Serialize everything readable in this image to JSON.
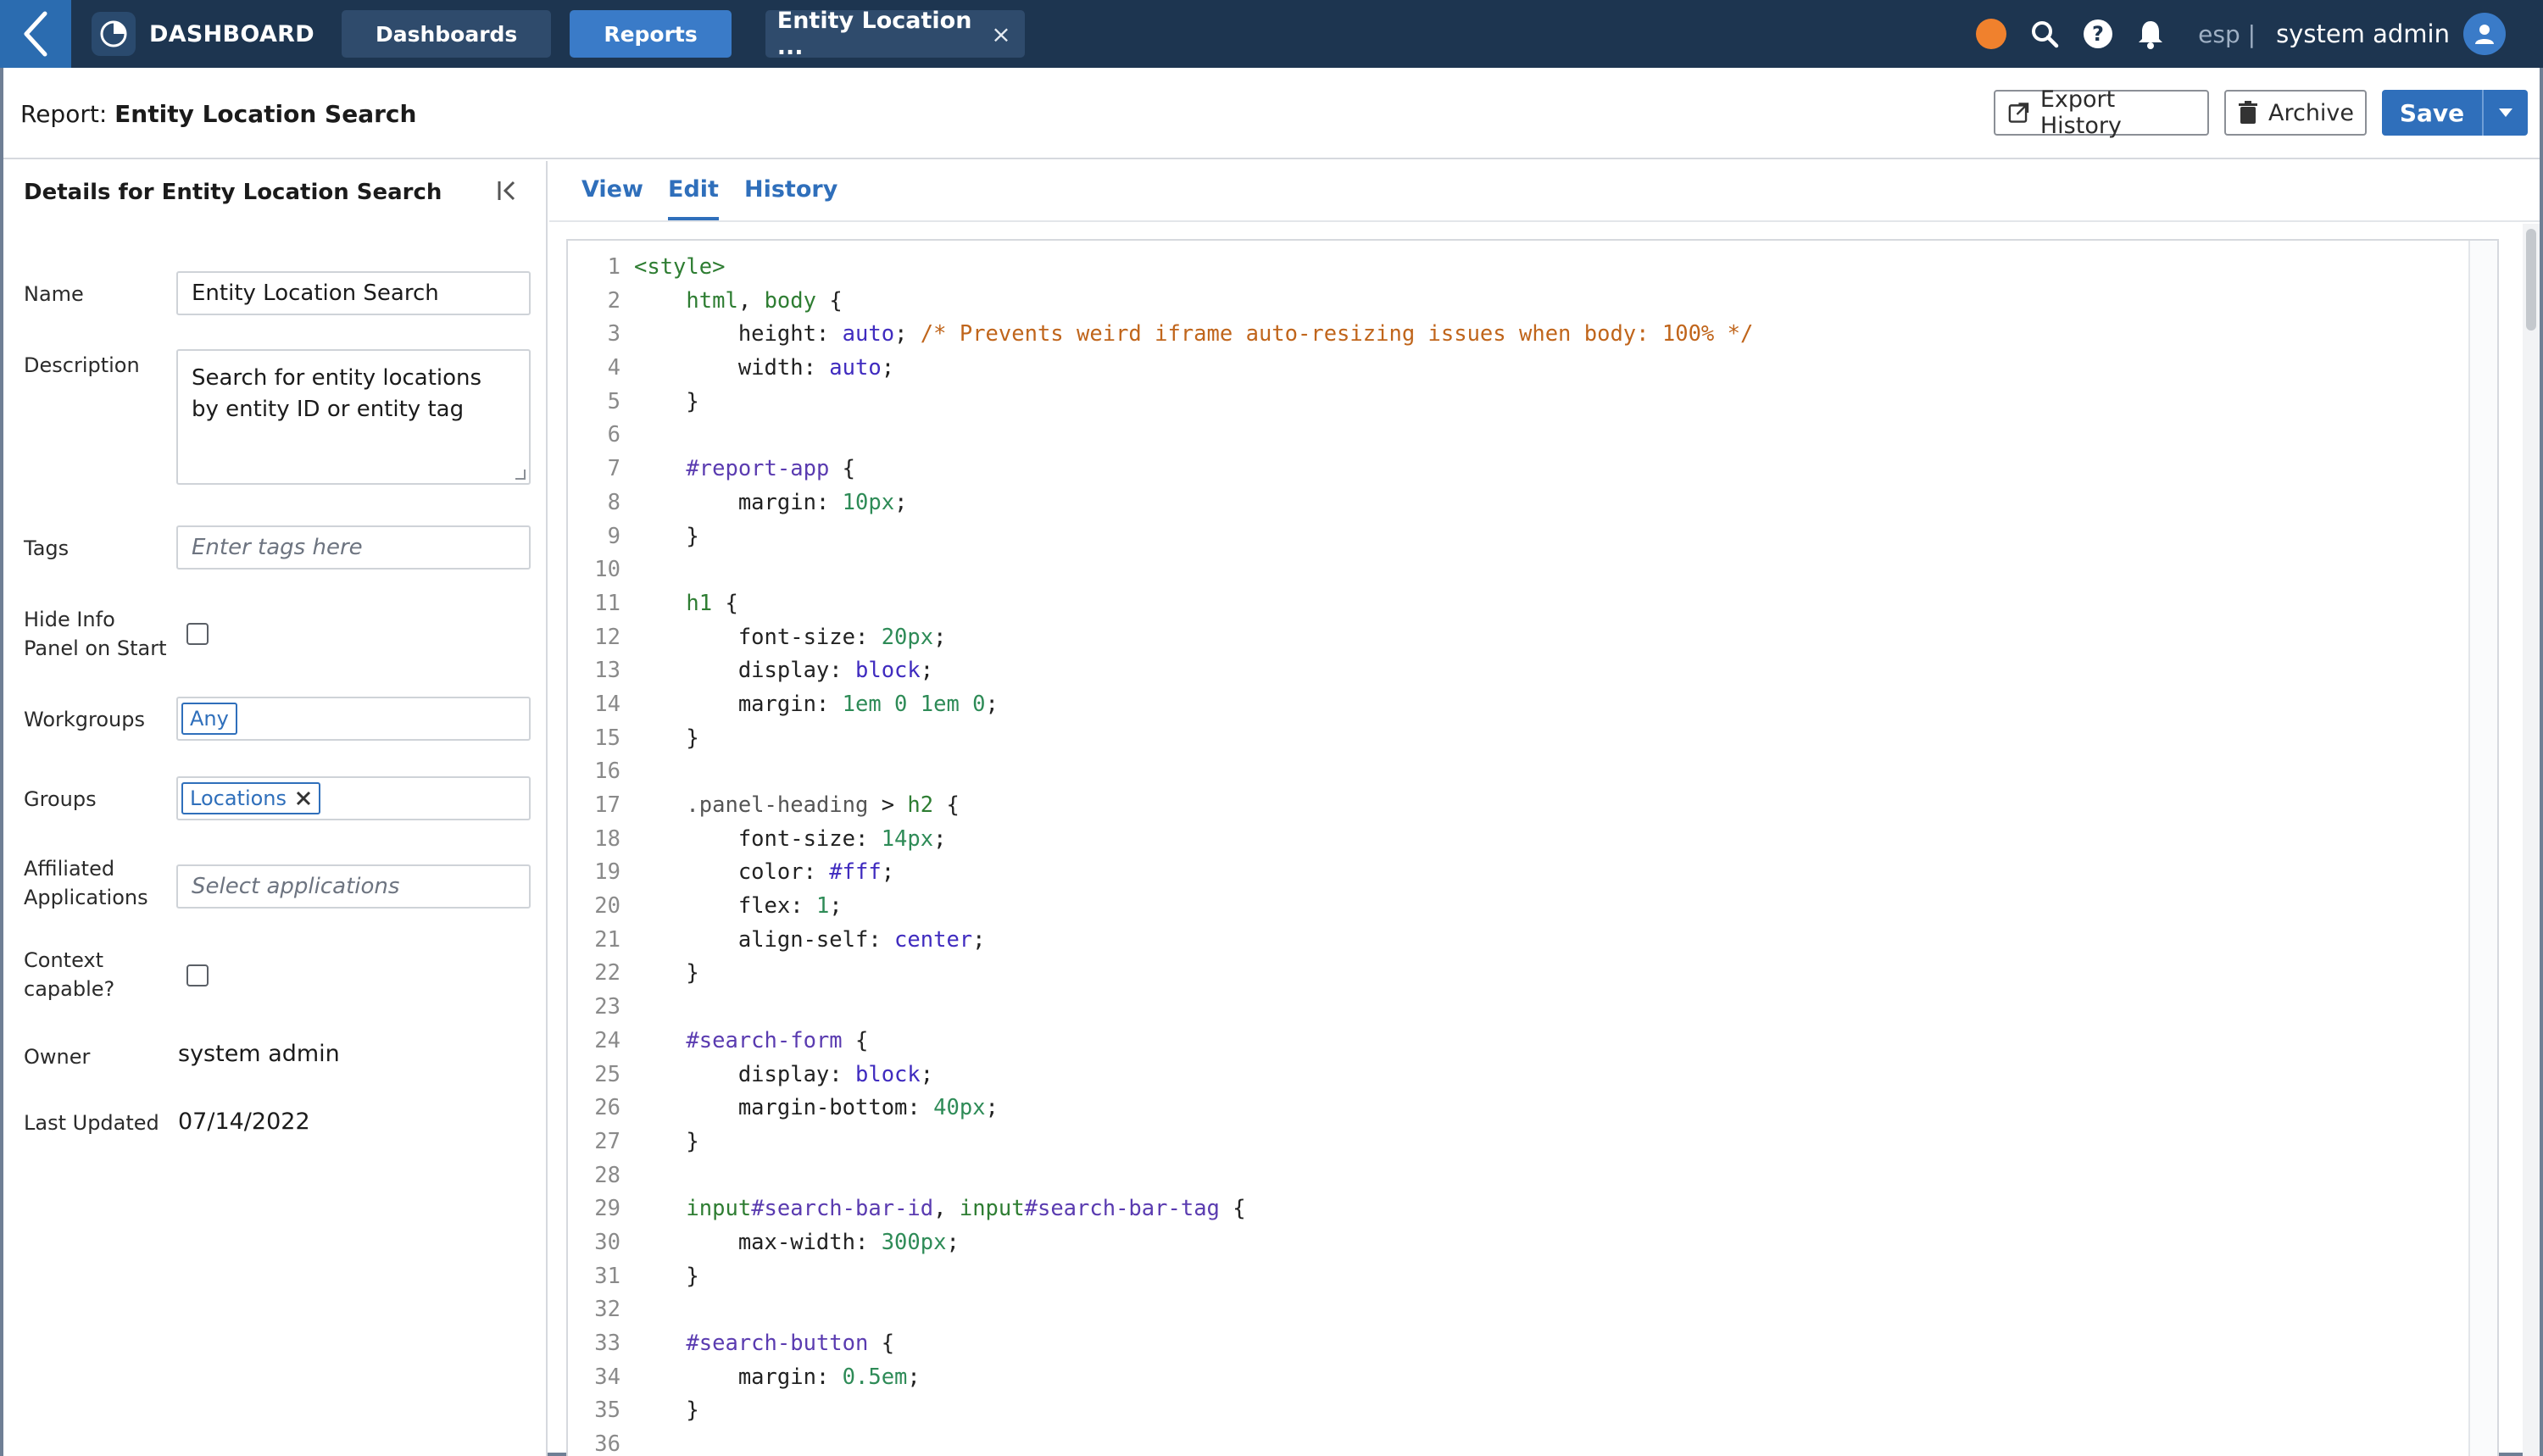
{
  "topbar": {
    "brand": "DASHBOARD",
    "nav": [
      "Dashboards",
      "Reports"
    ],
    "open_tab": "Entity Location ...",
    "open_tab_close": "×",
    "lang": "esp |",
    "user": "system admin",
    "colors": {
      "bar": "#1d3550",
      "accent": "#3a7bc8",
      "status_dot": "#f0812d"
    }
  },
  "header": {
    "title_prefix": "Report: ",
    "title": "Entity Location Search",
    "export_label": "Export History",
    "archive_label": "Archive",
    "save_label": "Save"
  },
  "details": {
    "panel_title": "Details for Entity Location Search",
    "name_label": "Name",
    "name_value": "Entity Location Search",
    "description_label": "Description",
    "description_value": "Search for entity locations by entity ID or entity tag",
    "tags_label": "Tags",
    "tags_placeholder": "Enter tags here",
    "hide_info_label": "Hide Info Panel on Start",
    "workgroups_label": "Workgroups",
    "workgroups_chip": "Any",
    "groups_label": "Groups",
    "groups_chip": "Locations",
    "affiliated_label": "Affiliated Applications",
    "affiliated_placeholder": "Select applications",
    "context_label": "Context capable?",
    "owner_label": "Owner",
    "owner_value": "system admin",
    "last_updated_label": "Last Updated",
    "last_updated_value": "07/14/2022"
  },
  "tabs": [
    "View",
    "Edit",
    "History"
  ],
  "active_tab": "Edit",
  "code": [
    [
      [
        "<style>",
        "tag"
      ]
    ],
    [
      [
        "    ",
        ""
      ],
      [
        "html",
        "tag"
      ],
      [
        ", ",
        ""
      ],
      [
        "body",
        "tag"
      ],
      [
        " {",
        ""
      ]
    ],
    [
      [
        "        height: ",
        ""
      ],
      [
        "auto",
        "val"
      ],
      [
        "; ",
        ""
      ],
      [
        "/* Prevents weird iframe auto-resizing issues when body: 100% */",
        "com"
      ]
    ],
    [
      [
        "        width: ",
        ""
      ],
      [
        "auto",
        "val"
      ],
      [
        ";",
        ""
      ]
    ],
    [
      [
        "    }",
        ""
      ]
    ],
    [
      [
        "",
        ""
      ]
    ],
    [
      [
        "    ",
        ""
      ],
      [
        "#report-app",
        "id"
      ],
      [
        " {",
        ""
      ]
    ],
    [
      [
        "        margin: ",
        ""
      ],
      [
        "10px",
        "num"
      ],
      [
        ";",
        ""
      ]
    ],
    [
      [
        "    }",
        ""
      ]
    ],
    [
      [
        "",
        ""
      ]
    ],
    [
      [
        "    ",
        ""
      ],
      [
        "h1",
        "tag"
      ],
      [
        " {",
        ""
      ]
    ],
    [
      [
        "        font-size: ",
        ""
      ],
      [
        "20px",
        "num"
      ],
      [
        ";",
        ""
      ]
    ],
    [
      [
        "        display: ",
        ""
      ],
      [
        "block",
        "val"
      ],
      [
        ";",
        ""
      ]
    ],
    [
      [
        "        margin: ",
        ""
      ],
      [
        "1em 0 1em 0",
        "num"
      ],
      [
        ";",
        ""
      ]
    ],
    [
      [
        "    }",
        ""
      ]
    ],
    [
      [
        "",
        ""
      ]
    ],
    [
      [
        "    ",
        ""
      ],
      [
        ".panel-heading",
        "cls"
      ],
      [
        " > ",
        ""
      ],
      [
        "h2",
        "tag"
      ],
      [
        " {",
        ""
      ]
    ],
    [
      [
        "        font-size: ",
        ""
      ],
      [
        "14px",
        "num"
      ],
      [
        ";",
        ""
      ]
    ],
    [
      [
        "        color: ",
        ""
      ],
      [
        "#fff",
        "val"
      ],
      [
        ";",
        ""
      ]
    ],
    [
      [
        "        flex: ",
        ""
      ],
      [
        "1",
        "num"
      ],
      [
        ";",
        ""
      ]
    ],
    [
      [
        "        align-self: ",
        ""
      ],
      [
        "center",
        "val"
      ],
      [
        ";",
        ""
      ]
    ],
    [
      [
        "    }",
        ""
      ]
    ],
    [
      [
        "",
        ""
      ]
    ],
    [
      [
        "    ",
        ""
      ],
      [
        "#search-form",
        "id"
      ],
      [
        " {",
        ""
      ]
    ],
    [
      [
        "        display: ",
        ""
      ],
      [
        "block",
        "val"
      ],
      [
        ";",
        ""
      ]
    ],
    [
      [
        "        margin-bottom: ",
        ""
      ],
      [
        "40px",
        "num"
      ],
      [
        ";",
        ""
      ]
    ],
    [
      [
        "    }",
        ""
      ]
    ],
    [
      [
        "",
        ""
      ]
    ],
    [
      [
        "    ",
        ""
      ],
      [
        "input",
        "tag"
      ],
      [
        "#search-bar-id",
        "id"
      ],
      [
        ", ",
        ""
      ],
      [
        "input",
        "tag"
      ],
      [
        "#search-bar-tag",
        "id"
      ],
      [
        " {",
        ""
      ]
    ],
    [
      [
        "        max-width: ",
        ""
      ],
      [
        "300px",
        "num"
      ],
      [
        ";",
        ""
      ]
    ],
    [
      [
        "    }",
        ""
      ]
    ],
    [
      [
        "",
        ""
      ]
    ],
    [
      [
        "    ",
        ""
      ],
      [
        "#search-button",
        "id"
      ],
      [
        " {",
        ""
      ]
    ],
    [
      [
        "        margin: ",
        ""
      ],
      [
        "0.5em",
        "num"
      ],
      [
        ";",
        ""
      ]
    ],
    [
      [
        "    }",
        ""
      ]
    ],
    [
      [
        "",
        ""
      ]
    ]
  ]
}
